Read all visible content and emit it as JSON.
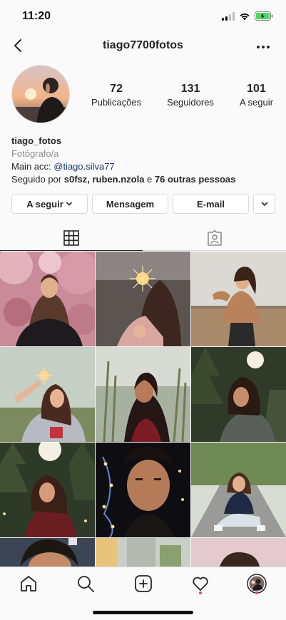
{
  "status": {
    "time": "11:20"
  },
  "nav": {
    "title": "tiago7700fotos"
  },
  "stats": [
    {
      "value": "72",
      "label": "Publicações"
    },
    {
      "value": "131",
      "label": "Seguidores"
    },
    {
      "value": "101",
      "label": "A seguir"
    }
  ],
  "bio": {
    "name": "tiago_fotos",
    "category": "Fotógrafo/a",
    "line_prefix": "Main acc: ",
    "line_link": "@tiago.silva77",
    "followed_prefix": "Seguido por ",
    "followed_names": "s0fsz, ruben.nzola",
    "followed_mid": " e ",
    "followed_count": "76 outras pessoas"
  },
  "actions": {
    "following_label": "A seguir",
    "message_label": "Mensagem",
    "email_label": "E-mail"
  },
  "tabs": [
    {
      "name": "grid-icon",
      "active": true
    },
    {
      "name": "tagged-icon",
      "active": false
    }
  ],
  "bottom_nav": [
    {
      "name": "home-icon"
    },
    {
      "name": "search-icon"
    },
    {
      "name": "new-post-icon"
    },
    {
      "name": "activity-heart-icon"
    },
    {
      "name": "profile-icon"
    }
  ],
  "colors": {
    "link": "#1f3a6d",
    "notification": "#ed4956",
    "text": "#262626",
    "secondary": "#8e8e8e"
  }
}
